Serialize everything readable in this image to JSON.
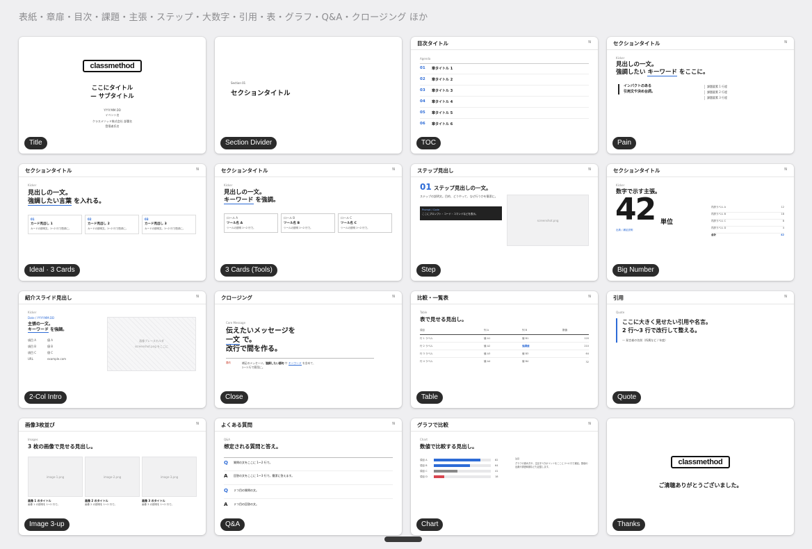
{
  "header": "表紙・章扉・目次・課題・主張・ステップ・大数字・引用・表・グラフ・Q&A・クロージング ほか",
  "common": {
    "n": "N",
    "kicker": "Kicker"
  },
  "cards": {
    "title": {
      "badge": "Title",
      "logo": "classmethod",
      "t1": "ここにタイトル",
      "t2": "— サブタイトル",
      "date": "YYYY.MM.DD",
      "event": "イベント名",
      "company": "クラスメソッド株式会社 部署名",
      "name": "登壇者氏名"
    },
    "section": {
      "badge": "Section Divider",
      "num": "Section 01",
      "title": "セクションタイトル"
    },
    "toc": {
      "badge": "TOC",
      "head": "目次タイトル",
      "agenda": "Agenda",
      "items": [
        {
          "n": "01",
          "t": "章タイトル 1"
        },
        {
          "n": "02",
          "t": "章タイトル 2"
        },
        {
          "n": "03",
          "t": "章タイトル 3"
        },
        {
          "n": "04",
          "t": "章タイトル 4"
        },
        {
          "n": "05",
          "t": "章タイトル 5"
        },
        {
          "n": "06",
          "t": "章タイトル 6"
        }
      ]
    },
    "pain": {
      "badge": "Pain",
      "head": "セクションタイトル",
      "l1": "見出しの一文。",
      "l2a": "強調したい ",
      "l2b": "キーワード",
      "l2c": " をここに。",
      "q1": "インパクトのある",
      "q2": "引用文や決め台詞。",
      "items": [
        "課題要素 1 行程",
        "課題要素 2 行程",
        "課題要素 3 行程"
      ]
    },
    "ideal": {
      "badge": "Ideal · 3 Cards",
      "head": "セクションタイトル",
      "l1": "見出しの一文。",
      "l2a": "強調したい言葉",
      "l2b": " を入れる。",
      "cards": [
        {
          "n": "01",
          "t": "カード見出し 1",
          "d": "カードの説明文。1〜2 行で簡潔に。"
        },
        {
          "n": "02",
          "t": "カード見出し 2",
          "d": "カードの説明文。1〜2 行で簡潔に。"
        },
        {
          "n": "03",
          "t": "カード見出し 3",
          "d": "カードの説明文。1〜2 行で簡潔に。"
        }
      ]
    },
    "tools": {
      "badge": "3 Cards (Tools)",
      "head": "セクションタイトル",
      "l1": "見出しの一文。",
      "l2a": "キーワード",
      "l2b": " を強調。",
      "cards": [
        {
          "r": "ロール A",
          "t": "ツール名 A",
          "d": "ツールの説明 1〜2 行で。"
        },
        {
          "r": "ロール B",
          "t": "ツール名 B",
          "d": "ツールの説明 1〜2 行で。"
        },
        {
          "r": "ロール C",
          "t": "ツール名 C",
          "d": "ツールの説明 1〜2 行で。"
        }
      ]
    },
    "step": {
      "badge": "Step",
      "head": "ステップ見出し",
      "num": "01",
      "title": "ステップ見出しの一文。",
      "desc": "ステップの説明文。目的、どうやって、なぜ行うかを簡潔に。",
      "code_label": "Prompt / Code",
      "code": "ここにプロンプト・コード・コマンドなどを表示。",
      "shot": "screenshot.png"
    },
    "bignum": {
      "badge": "Big Number",
      "head": "セクションタイトル",
      "claim": "数字で示す主張。",
      "num": "42",
      "unit": "単位",
      "note": "出典 / 補足説明",
      "rows": [
        {
          "k": "内訳ラベル A",
          "v": "12"
        },
        {
          "k": "内訳ラベル B",
          "v": "18"
        },
        {
          "k": "内訳ラベル C",
          "v": "8"
        },
        {
          "k": "内訳ラベル D",
          "v": "4"
        },
        {
          "k": "合計",
          "v": "42"
        }
      ]
    },
    "intro": {
      "badge": "2-Col Intro",
      "head": "紹介スライド見出し",
      "meta": "Date / YYYY.MM.DD",
      "l1": "主張の一文。",
      "l2a": "キーワード",
      "l2b": " を強調。",
      "rows": [
        {
          "k": "項目 A",
          "v": "値 A"
        },
        {
          "k": "項目 B",
          "v": "値 B"
        },
        {
          "k": "項目 C",
          "v": "値 C"
        },
        {
          "k": "URL",
          "v": "example.com"
        }
      ],
      "img1": "画像プレースホルダ",
      "img2": "screenshot.png をここに"
    },
    "close": {
      "badge": "Close",
      "head": "クロージング",
      "kicker": "Core Message",
      "l1": "伝えたいメッセージを",
      "l2a": "一文",
      "l2b": " で。",
      "l3": "改行で間を作る。",
      "tag": "要約",
      "n1a": "補足のメッセージ。",
      "n1b": "強調したい語句",
      "n1c": " や ",
      "n1d": "キーワード",
      "n1e": " を含めて、",
      "n2": "2〜3 行で簡潔に。"
    },
    "table": {
      "badge": "Table",
      "head": "比較・一覧表",
      "kicker": "Table",
      "title": "表で見せる見出し。",
      "cols": [
        "項目",
        "列 A",
        "列 B",
        "数値"
      ],
      "rows": [
        [
          "行 1 ラベル",
          "値 A1",
          "値 B1",
          "120"
        ],
        [
          "行 2 ラベル",
          "値 A2",
          "強調値",
          "210"
        ],
        [
          "行 3 ラベル",
          "値 A3",
          "値 B3",
          "64"
        ],
        [
          "行 4 ラベル",
          "値 A4",
          "値 B4",
          "32"
        ]
      ]
    },
    "quote": {
      "badge": "Quote",
      "head": "引用",
      "kicker": "Quote",
      "l1": "ここに大きく見せたい引用や名言。",
      "l2": "2 行〜3 行で改行して整える。",
      "src": "— 発言者の名前（所属など / 年度）"
    },
    "images": {
      "badge": "Image 3-up",
      "head": "画像3枚並び",
      "kicker": "Images",
      "title": "3 枚の画像で見せる見出し。",
      "items": [
        {
          "img": "image-1.png",
          "t": "画像 1 のタイトル",
          "d": "画像 1 の説明を 1〜2 行で。"
        },
        {
          "img": "image-2.png",
          "t": "画像 2 のタイトル",
          "d": "画像 2 の説明を 1〜2 行で。"
        },
        {
          "img": "image-3.png",
          "t": "画像 3 のタイトル",
          "d": "画像 3 の説明を 1〜2 行で。"
        }
      ]
    },
    "qa": {
      "badge": "Q&A",
      "head": "よくある質問",
      "kicker": "Q&A",
      "title": "想定される質問と答え。",
      "items": [
        {
          "m": "Q",
          "t": "質問の文をここに 1〜2 行で。"
        },
        {
          "m": "A",
          "t": "回答の文をここに 1〜3 行で。簡潔に答えます。"
        },
        {
          "m": "Q",
          "t": "２つ目の質問の文。"
        },
        {
          "m": "A",
          "t": "２つ目の回答の文。"
        }
      ]
    },
    "chart": {
      "badge": "Chart",
      "head": "グラフで比較",
      "kicker": "Chart",
      "title": "数値で比較する見出し。",
      "bars": [
        {
          "k": "項目 A",
          "v": 82
        },
        {
          "k": "項目 B",
          "v": 64
        },
        {
          "k": "項目 C",
          "v": 41
        },
        {
          "k": "項目 D",
          "v": 18
        }
      ],
      "side": "グラフの読み方や、注目すべきポイントをここに 2〜4 行で補足。数値の出典や調査時期なども記載します。",
      "note": "注目"
    },
    "thanks": {
      "badge": "Thanks",
      "logo": "classmethod",
      "text": "ご清聴ありがとうございました。"
    }
  }
}
